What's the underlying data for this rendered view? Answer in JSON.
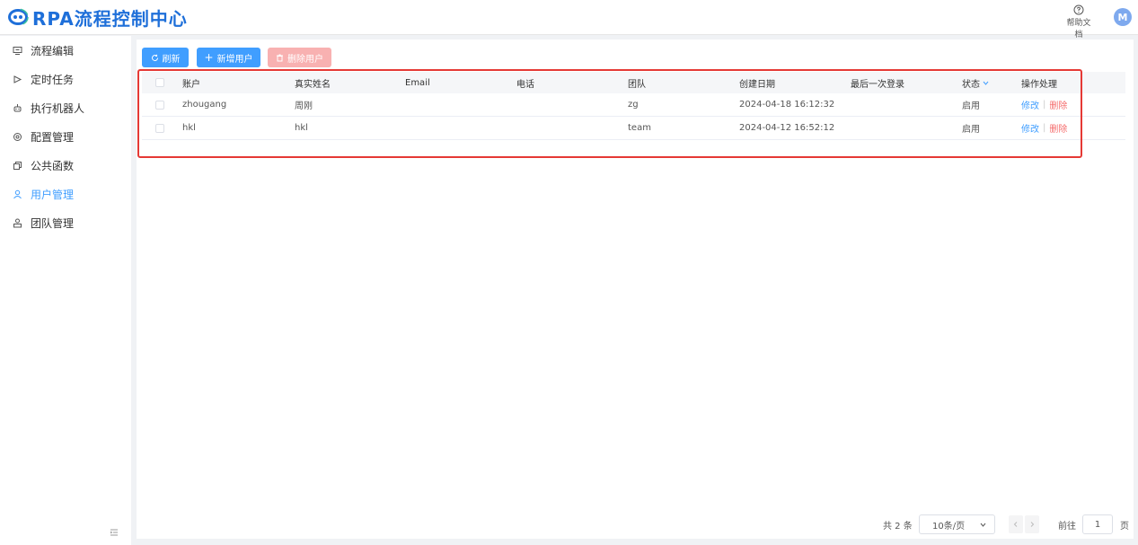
{
  "app": {
    "title": "RPA流程控制中心",
    "brand_color": "#1e6fd9",
    "accent": "#409eff",
    "danger": "#f56c6c"
  },
  "header": {
    "help_label": "帮助文档",
    "help_icon": "help-circle-icon",
    "avatar_initial": "M"
  },
  "sidebar": {
    "items": [
      {
        "label": "流程编辑",
        "icon": "monitor-icon"
      },
      {
        "label": "定时任务",
        "icon": "play-icon"
      },
      {
        "label": "执行机器人",
        "icon": "robot-icon"
      },
      {
        "label": "配置管理",
        "icon": "settings-icon"
      },
      {
        "label": "公共函数",
        "icon": "copy-icon"
      },
      {
        "label": "用户管理",
        "icon": "user-icon",
        "active": true
      },
      {
        "label": "团队管理",
        "icon": "team-icon"
      }
    ]
  },
  "toolbar": {
    "refresh_label": "刷新",
    "add_label": "新增用户",
    "delete_label": "删除用户"
  },
  "table": {
    "columns": [
      "账户",
      "真实姓名",
      "Email",
      "电话",
      "团队",
      "创建日期",
      "最后一次登录",
      "状态",
      "操作处理"
    ],
    "rows": [
      {
        "account": "zhougang",
        "real_name": "周刚",
        "email": "",
        "phone": "",
        "team": "zg",
        "created": "2024-04-18 16:12:32",
        "last_login": "",
        "status": "启用",
        "edit": "修改",
        "delete": "删除"
      },
      {
        "account": "hkl",
        "real_name": "hkl",
        "email": "",
        "phone": "",
        "team": "team",
        "created": "2024-04-12 16:52:12",
        "last_login": "",
        "status": "启用",
        "edit": "修改",
        "delete": "删除"
      }
    ]
  },
  "pagination": {
    "total": "共 2 条",
    "page_size": "10条/页",
    "goto_label": "前往",
    "current_page": "1",
    "page_suffix": "页"
  }
}
